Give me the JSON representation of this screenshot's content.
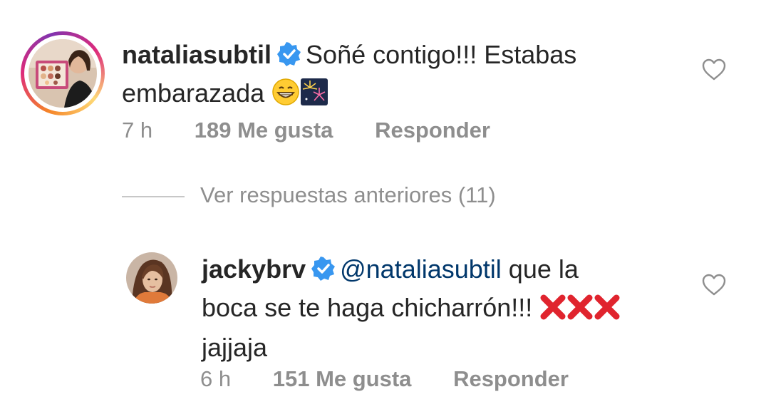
{
  "comments": [
    {
      "username": "nataliasubtil",
      "text_line1": "Soñé contigo!!! Estabas",
      "text_line2": "embarazada",
      "emojis": [
        "grinning-face-emoji",
        "fireworks-emoji"
      ],
      "time": "7 h",
      "likes": "189 Me gusta",
      "reply_label": "Responder"
    },
    {
      "username": "jackybrv",
      "mention": "@nataliasubtil",
      "text_line1": "que la",
      "text_line2": "boca se te haga chicharrón!!!",
      "text_line3": "jajjaja",
      "emojis": [
        "cross-mark-emoji",
        "cross-mark-emoji",
        "cross-mark-emoji"
      ],
      "time": "6 h",
      "likes": "151 Me gusta",
      "reply_label": "Responder"
    }
  ],
  "view_replies": "Ver respuestas anteriores (11)",
  "colors": {
    "text": "#262626",
    "secondary": "#8e8e8e",
    "mention": "#00376b",
    "verified": "#3897f0"
  }
}
